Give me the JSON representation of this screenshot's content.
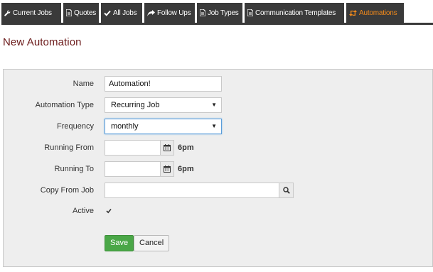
{
  "tabs": [
    {
      "label": "Current Jobs",
      "icon": "wrench-icon"
    },
    {
      "label": "Quotes",
      "icon": "document-icon"
    },
    {
      "label": "All Jobs",
      "icon": "check-icon"
    },
    {
      "label": "Follow Ups",
      "icon": "share-arrow-icon"
    },
    {
      "label": "Job Types",
      "icon": "document-icon"
    },
    {
      "label": "Communication Templates",
      "icon": "document-icon"
    },
    {
      "label": "Automations",
      "icon": "retweet-icon",
      "active": true
    }
  ],
  "page": {
    "title": "New Automation"
  },
  "form": {
    "name_label": "Name",
    "name_value": "Automation!",
    "type_label": "Automation Type",
    "type_value": "Recurring Job",
    "frequency_label": "Frequency",
    "frequency_value": "monthly",
    "running_from_label": "Running From",
    "running_from_time": "6pm",
    "running_to_label": "Running To",
    "running_to_time": "6pm",
    "copy_from_label": "Copy From Job",
    "active_label": "Active",
    "active_checked": true,
    "save_label": "Save",
    "cancel_label": "Cancel"
  },
  "colors": {
    "tab_bg": "#3a3a3a",
    "tab_active_text": "#f28a1b",
    "title": "#6b1a1a",
    "save_bg": "#4aa747",
    "panel_bg": "#eeeeee"
  }
}
